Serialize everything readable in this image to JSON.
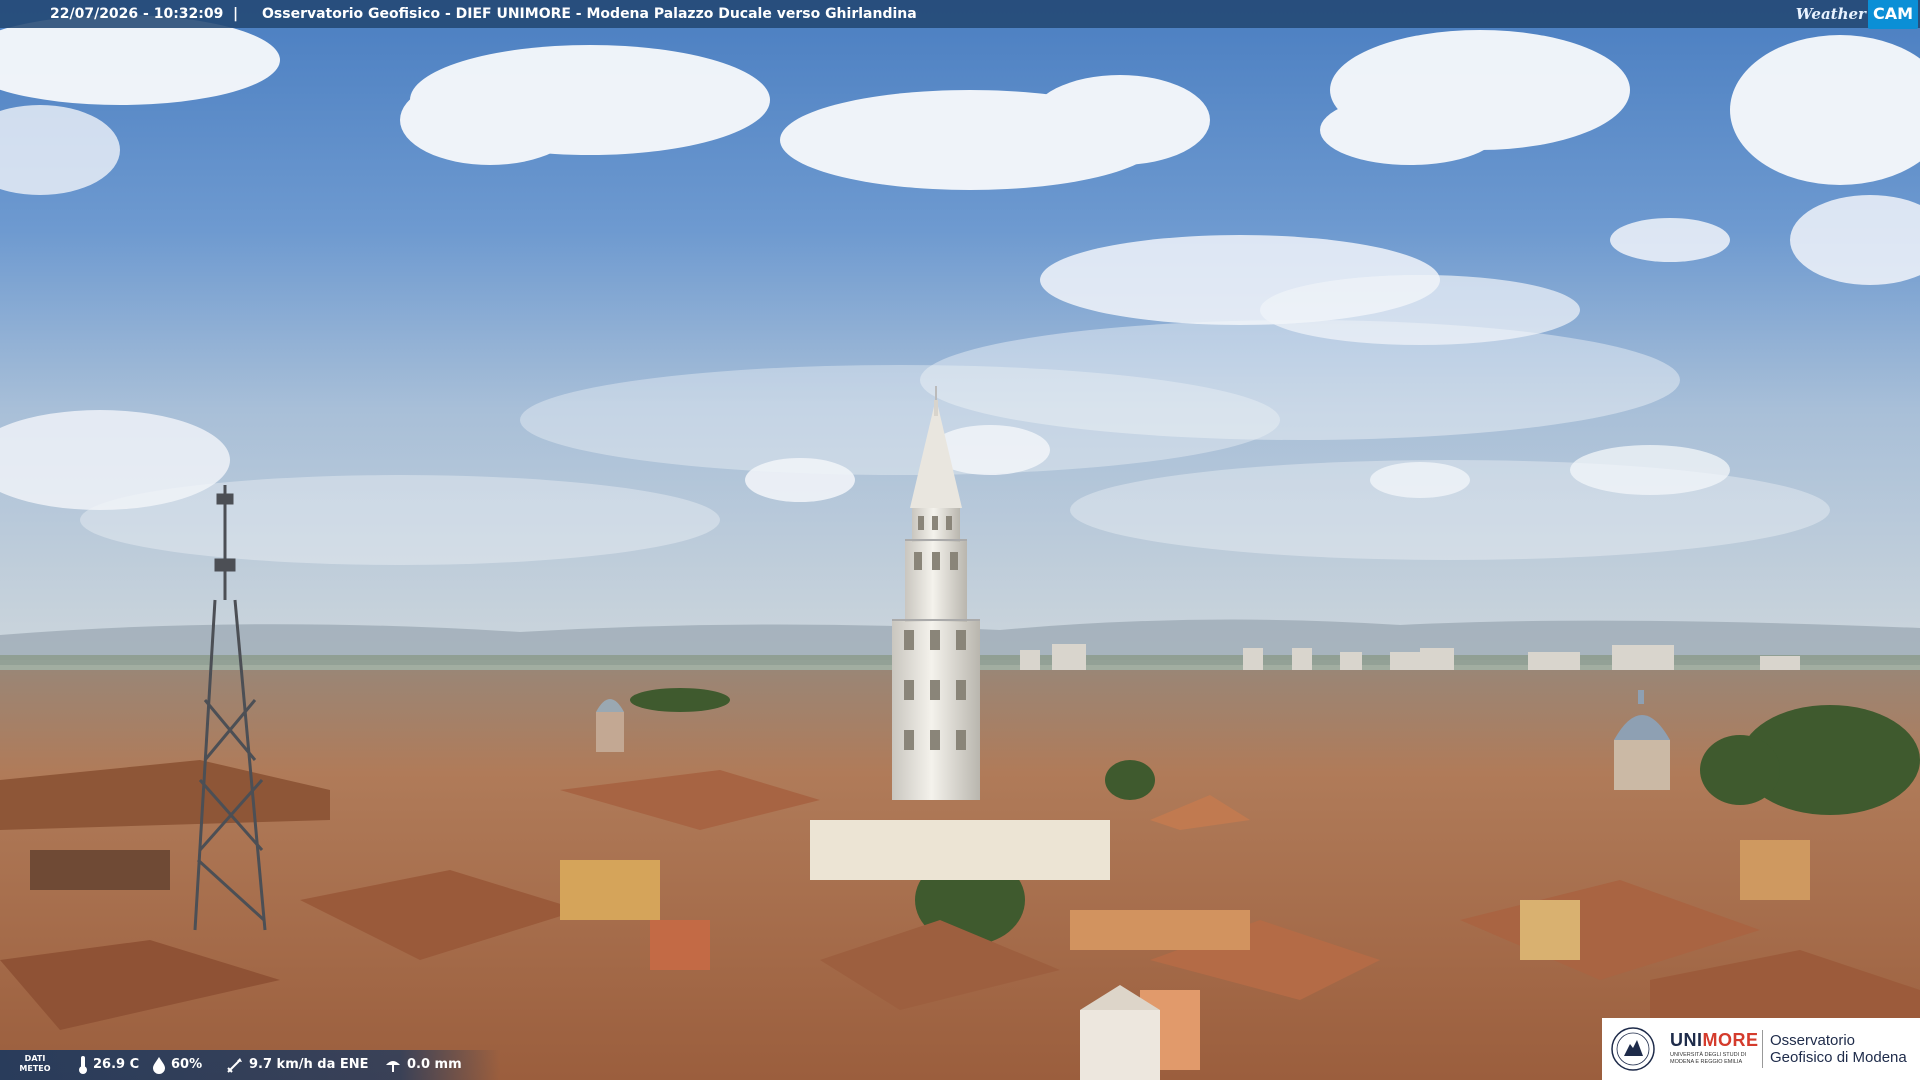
{
  "overlay": {
    "timestamp": "22/07/2026 - 10:32:09",
    "separator": "|",
    "title": "Osservatorio Geofisico - DIEF UNIMORE - Modena Palazzo Ducale verso Ghirlandina",
    "weathercam_logo": {
      "word": "Weather",
      "cam": "CAM"
    }
  },
  "weather": {
    "label": "DATI METEO",
    "temperature": "26.9 C",
    "humidity": "60%",
    "wind": "9.7 km/h da ENE",
    "rain": "0.0 mm"
  },
  "unimore_logo": {
    "name_a": "UNI",
    "name_b": "MORE",
    "subtitle": "UNIVERSITÀ DEGLI STUDI DI MODENA E REGGIO EMILIA",
    "observatory": "Osservatorio Geofisico di Modena"
  },
  "colors": {
    "sky_top": "#4e81c2",
    "sky_horizon": "#c6d3de",
    "roof": "#b8764e",
    "tower": "#eeece6",
    "bar": "#234873",
    "unimore_red": "#d43b2c"
  },
  "icons": {
    "temperature": "thermometer-icon",
    "humidity": "droplet-icon",
    "wind": "wind-vane-icon",
    "rain": "rain-gauge-icon"
  }
}
